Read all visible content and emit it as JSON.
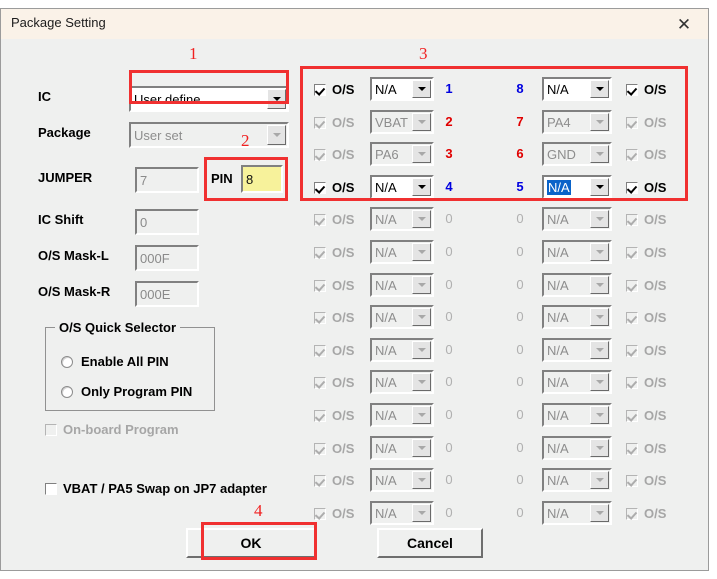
{
  "window": {
    "title": "Package Setting",
    "close_icon": "close-icon"
  },
  "left_panel": {
    "fields": [
      {
        "label": "IC",
        "value": "User define",
        "type": "combo",
        "enabled": true
      },
      {
        "label": "Package",
        "value": "User set",
        "type": "combo",
        "enabled": false
      },
      {
        "label": "JUMPER",
        "value": "7",
        "type": "textbox",
        "enabled": false
      },
      {
        "label": "IC Shift",
        "value": "0",
        "type": "textbox",
        "enabled": false
      },
      {
        "label": "O/S Mask-L",
        "value": "000F",
        "type": "textbox",
        "enabled": false
      },
      {
        "label": "O/S Mask-R",
        "value": "000E",
        "type": "textbox",
        "enabled": false
      }
    ],
    "pin_label": "PIN",
    "pin_value": "8",
    "quick_selector": {
      "title": "O/S Quick Selector",
      "options": [
        {
          "label": "Enable All PIN",
          "selected": false
        },
        {
          "label": "Only Program PIN",
          "selected": false
        }
      ]
    },
    "onboard_program": {
      "label": "On-board Program",
      "checked": false,
      "enabled": false
    },
    "vbat_swap": {
      "label": "VBAT / PA5 Swap on JP7 adapter",
      "checked": false,
      "enabled": true
    }
  },
  "pin_rows": [
    {
      "left_os": "O/S",
      "left_checked": true,
      "left_enabled": true,
      "left_value": "N/A",
      "left_pin": "1",
      "left_pin_color": "blue",
      "right_pin": "8",
      "right_pin_color": "blue",
      "right_value": "N/A",
      "right_os": "O/S",
      "right_checked": true,
      "right_enabled": true,
      "right_focus": false
    },
    {
      "left_os": "O/S",
      "left_checked": true,
      "left_enabled": false,
      "left_value": "VBAT",
      "left_pin": "2",
      "left_pin_color": "red",
      "right_pin": "7",
      "right_pin_color": "red",
      "right_value": "PA4",
      "right_os": "O/S",
      "right_checked": true,
      "right_enabled": false,
      "right_focus": false
    },
    {
      "left_os": "O/S",
      "left_checked": true,
      "left_enabled": false,
      "left_value": "PA6",
      "left_pin": "3",
      "left_pin_color": "red",
      "right_pin": "6",
      "right_pin_color": "red",
      "right_value": "GND",
      "right_os": "O/S",
      "right_checked": true,
      "right_enabled": false,
      "right_focus": false
    },
    {
      "left_os": "O/S",
      "left_checked": true,
      "left_enabled": true,
      "left_value": "N/A",
      "left_pin": "4",
      "left_pin_color": "blue",
      "right_pin": "5",
      "right_pin_color": "blue",
      "right_value": "N/A",
      "right_os": "O/S",
      "right_checked": true,
      "right_enabled": true,
      "right_focus": true
    },
    {
      "left_os": "O/S",
      "left_checked": true,
      "left_enabled": false,
      "left_value": "N/A",
      "left_pin": "0",
      "left_pin_color": "off",
      "right_pin": "0",
      "right_pin_color": "off",
      "right_value": "N/A",
      "right_os": "O/S",
      "right_checked": true,
      "right_enabled": false,
      "right_focus": false
    },
    {
      "left_os": "O/S",
      "left_checked": true,
      "left_enabled": false,
      "left_value": "N/A",
      "left_pin": "0",
      "left_pin_color": "off",
      "right_pin": "0",
      "right_pin_color": "off",
      "right_value": "N/A",
      "right_os": "O/S",
      "right_checked": true,
      "right_enabled": false,
      "right_focus": false
    },
    {
      "left_os": "O/S",
      "left_checked": true,
      "left_enabled": false,
      "left_value": "N/A",
      "left_pin": "0",
      "left_pin_color": "off",
      "right_pin": "0",
      "right_pin_color": "off",
      "right_value": "N/A",
      "right_os": "O/S",
      "right_checked": true,
      "right_enabled": false,
      "right_focus": false
    },
    {
      "left_os": "O/S",
      "left_checked": true,
      "left_enabled": false,
      "left_value": "N/A",
      "left_pin": "0",
      "left_pin_color": "off",
      "right_pin": "0",
      "right_pin_color": "off",
      "right_value": "N/A",
      "right_os": "O/S",
      "right_checked": true,
      "right_enabled": false,
      "right_focus": false
    },
    {
      "left_os": "O/S",
      "left_checked": true,
      "left_enabled": false,
      "left_value": "N/A",
      "left_pin": "0",
      "left_pin_color": "off",
      "right_pin": "0",
      "right_pin_color": "off",
      "right_value": "N/A",
      "right_os": "O/S",
      "right_checked": true,
      "right_enabled": false,
      "right_focus": false
    },
    {
      "left_os": "O/S",
      "left_checked": true,
      "left_enabled": false,
      "left_value": "N/A",
      "left_pin": "0",
      "left_pin_color": "off",
      "right_pin": "0",
      "right_pin_color": "off",
      "right_value": "N/A",
      "right_os": "O/S",
      "right_checked": true,
      "right_enabled": false,
      "right_focus": false
    },
    {
      "left_os": "O/S",
      "left_checked": true,
      "left_enabled": false,
      "left_value": "N/A",
      "left_pin": "0",
      "left_pin_color": "off",
      "right_pin": "0",
      "right_pin_color": "off",
      "right_value": "N/A",
      "right_os": "O/S",
      "right_checked": true,
      "right_enabled": false,
      "right_focus": false
    },
    {
      "left_os": "O/S",
      "left_checked": true,
      "left_enabled": false,
      "left_value": "N/A",
      "left_pin": "0",
      "left_pin_color": "off",
      "right_pin": "0",
      "right_pin_color": "off",
      "right_value": "N/A",
      "right_os": "O/S",
      "right_checked": true,
      "right_enabled": false,
      "right_focus": false
    },
    {
      "left_os": "O/S",
      "left_checked": true,
      "left_enabled": false,
      "left_value": "N/A",
      "left_pin": "0",
      "left_pin_color": "off",
      "right_pin": "0",
      "right_pin_color": "off",
      "right_value": "N/A",
      "right_os": "O/S",
      "right_checked": true,
      "right_enabled": false,
      "right_focus": false
    },
    {
      "left_os": "O/S",
      "left_checked": true,
      "left_enabled": false,
      "left_value": "N/A",
      "left_pin": "0",
      "left_pin_color": "off",
      "right_pin": "0",
      "right_pin_color": "off",
      "right_value": "N/A",
      "right_os": "O/S",
      "right_checked": true,
      "right_enabled": false,
      "right_focus": false
    }
  ],
  "buttons": {
    "ok": "OK",
    "cancel": "Cancel"
  },
  "annotations": {
    "accent_color": "#f03030",
    "marks": [
      "1",
      "2",
      "3",
      "4"
    ]
  }
}
